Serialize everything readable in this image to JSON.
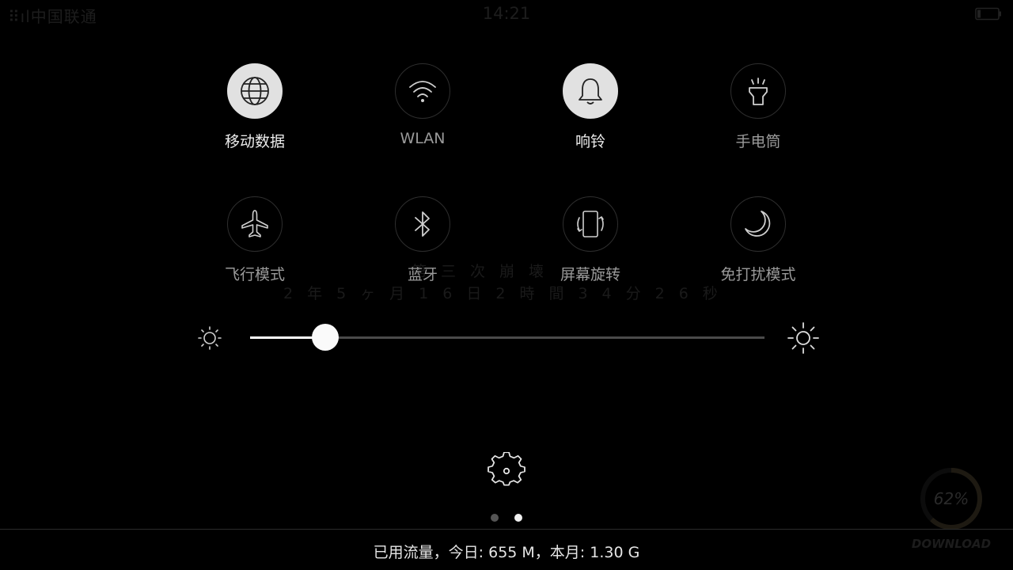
{
  "status_bar": {
    "carrier": "中国联通",
    "signal_prefix": "⠿ıl",
    "time": "14:21"
  },
  "toggles": [
    {
      "label": "移动数据",
      "icon": "globe-icon",
      "active": true
    },
    {
      "label": "WLAN",
      "icon": "wifi-icon",
      "active": false
    },
    {
      "label": "响铃",
      "icon": "bell-icon",
      "active": true
    },
    {
      "label": "手电筒",
      "icon": "flashlight-icon",
      "active": false
    },
    {
      "label": "飞行模式",
      "icon": "airplane-icon",
      "active": false
    },
    {
      "label": "蓝牙",
      "icon": "bluetooth-icon",
      "active": false
    },
    {
      "label": "屏幕旋转",
      "icon": "rotate-screen-icon",
      "active": false
    },
    {
      "label": "免打扰模式",
      "icon": "moon-icon",
      "active": false
    }
  ],
  "watermark": {
    "line1": "第三次崩壊",
    "line2": "2年5ヶ月16日2時間34分26秒"
  },
  "brightness": {
    "level": 0.146
  },
  "pager": {
    "count": 2,
    "active_index": 1
  },
  "download_overlay": {
    "percent": "62%",
    "label": "DOWNLOAD",
    "progress": 0.62
  },
  "footer": {
    "traffic_text": "已用流量，今日: 655 M，本月: 1.30 G"
  },
  "colors": {
    "background": "#000000",
    "active_toggle": "#e1e1e1",
    "inactive_label": "#9a9a9a"
  }
}
